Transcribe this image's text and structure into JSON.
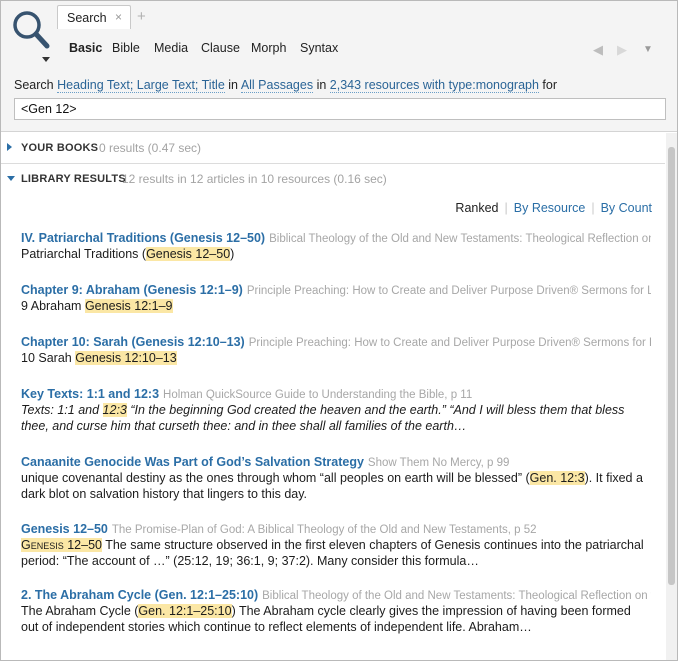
{
  "tab": {
    "label": "Search",
    "close": "×",
    "add": "+"
  },
  "modes": [
    {
      "label": "Basic",
      "active": true
    },
    {
      "label": "Bible",
      "active": false
    },
    {
      "label": "Media",
      "active": false
    },
    {
      "label": "Clause",
      "active": false
    },
    {
      "label": "Morph",
      "active": false
    },
    {
      "label": "Syntax",
      "active": false
    }
  ],
  "nav": {
    "back": "◀",
    "forward": "▶",
    "menu": "▼"
  },
  "query": {
    "prefix": "Search",
    "fields": "Heading Text; Large Text; Title",
    "in1": "in",
    "range": "All Passages",
    "in2": "in",
    "resources": "2,343 resources with type:monograph",
    "for": "for",
    "value": "<Gen 12>"
  },
  "your_books": {
    "title": "YOUR BOOKS",
    "stats": "0 results (0.47 sec)"
  },
  "library": {
    "title": "LIBRARY RESULTS",
    "stats": "12 results in 12 articles in 10 resources (0.16 sec)"
  },
  "sort": {
    "ranked": "Ranked",
    "by_resource": "By Resource",
    "by_count": "By Count"
  },
  "results": [
    {
      "title": "IV. Patriarchal Traditions (Genesis 12–50)",
      "source": "Biblical Theology of the Old and New Testaments: Theological Reflection on the Christian Bible",
      "lines": [
        "Patriarchal Traditions (",
        "Genesis 12–50",
        ")"
      ]
    },
    {
      "title": "Chapter 9: Abraham (Genesis 12:1–9)",
      "source": "Principle Preaching: How to Create and Deliver Purpose Driven® Sermons for Life Application",
      "lines": [
        "9 Abraham ",
        "Genesis 12:1–9"
      ]
    },
    {
      "title": "Chapter 10: Sarah (Genesis 12:10–13)",
      "source": "Principle Preaching: How to Create and Deliver Purpose Driven® Sermons for Life Application",
      "lines": [
        "10 Sarah ",
        "Genesis 12:10–13"
      ]
    },
    {
      "title": "Key Texts: 1:1 and 12:3",
      "source": "Holman QuickSource Guide to Understanding the Bible, p 11",
      "lines": [
        "Texts: 1:1 and ",
        "12:3",
        " “In the beginning God created the heaven and the earth.” “And I will bless them that bless thee, and curse him that curseth thee: and in thee shall all families of the earth…"
      ]
    },
    {
      "title": "Canaanite Genocide Was Part of God’s Salvation Strategy",
      "source": "Show Them No Mercy, p 99",
      "lines": [
        "unique covenantal destiny as the ones through whom “all peoples on earth will be blessed” (",
        "Gen. 12:3",
        "). It fixed a dark blot on salvation history that lingers to this day."
      ]
    },
    {
      "title": "Genesis 12–50",
      "source": "The Promise-Plan of God: A Biblical Theology of the Old and New Testaments, p 52",
      "lines": [
        "",
        "Genesis 12–50",
        " The same structure observed in the first eleven chapters of Genesis continues into the patriarchal period: “The account of …” (25:12, 19; 36:1, 9; 37:2). Many consider this formula…"
      ]
    },
    {
      "title": "2. The Abraham Cycle (Gen. 12:1–25:10)",
      "source": "Biblical Theology of the Old and New Testaments: Theological Reflection on the Christian Bible",
      "lines": [
        "The Abraham Cycle (",
        "Gen. 12:1–25:10",
        ") The Abraham cycle clearly gives the impression of having been formed out of independent stories which continue to reflect elements of independent life. Abraham…"
      ]
    }
  ]
}
